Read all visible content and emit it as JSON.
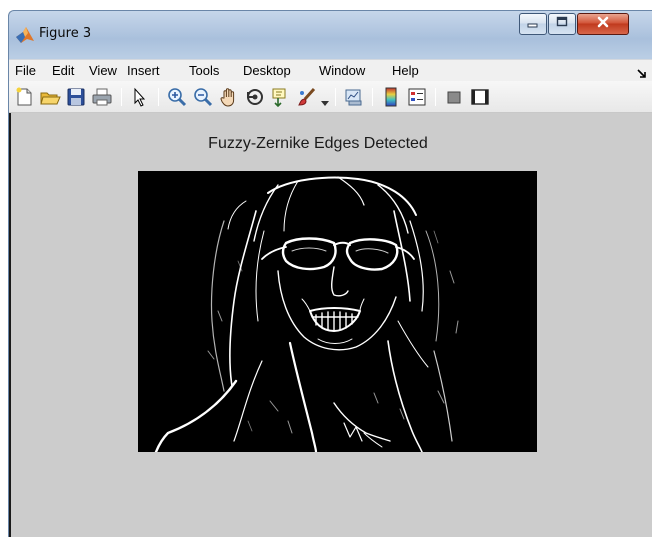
{
  "window": {
    "title": "Figure 3",
    "controls": {
      "minimize": "minimize",
      "maximize": "maximize",
      "close": "close"
    }
  },
  "menubar": {
    "items": [
      "File",
      "Edit",
      "View",
      "Insert",
      "Tools",
      "Desktop",
      "Window",
      "Help"
    ]
  },
  "toolbar": {
    "icons": [
      "new-figure-icon",
      "open-file-icon",
      "save-icon",
      "print-icon",
      "pointer-icon",
      "zoom-in-icon",
      "zoom-out-icon",
      "pan-hand-icon",
      "rotate-3d-icon",
      "data-cursor-icon",
      "brush-icon",
      "link-plot-icon",
      "colorbar-icon",
      "legend-icon",
      "hide-plot-tools-icon",
      "show-plot-tools-icon"
    ]
  },
  "figure": {
    "title": "Fuzzy-Zernike Edges Detected",
    "image": "edge-detected-portrait",
    "colors": {
      "background": "#cccccc",
      "image_bg": "#000000",
      "edges": "#ffffff"
    }
  }
}
